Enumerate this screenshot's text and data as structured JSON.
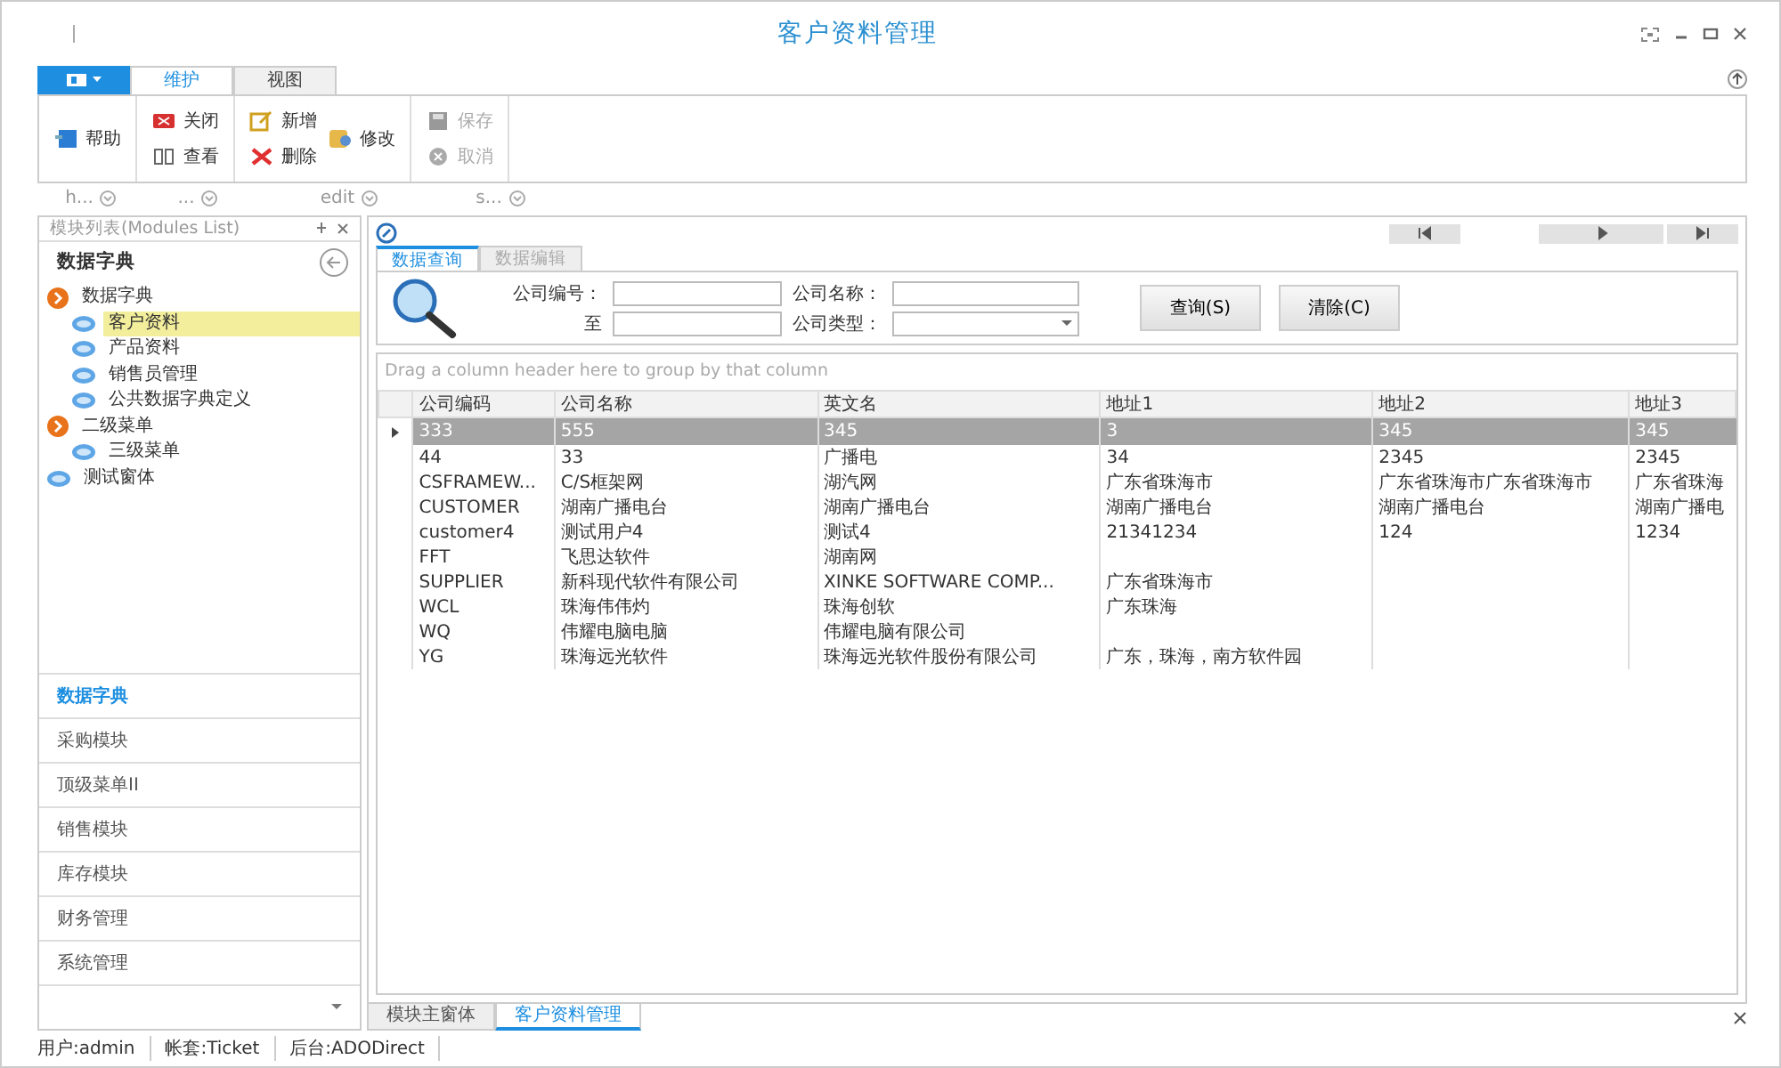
{
  "window": {
    "title": "客户资料管理"
  },
  "ribbon": {
    "tabs": [
      {
        "label": "维护",
        "selected": true
      },
      {
        "label": "视图",
        "selected": false
      }
    ],
    "groups": [
      {
        "label": "h...",
        "stacks": [
          [
            {
              "label": "帮助",
              "kind": "help",
              "disabled": false
            }
          ]
        ]
      },
      {
        "label": "...",
        "stacks": [
          [
            {
              "label": "关闭",
              "kind": "close",
              "disabled": false
            },
            {
              "label": "查看",
              "kind": "view",
              "disabled": false
            }
          ]
        ]
      },
      {
        "label": "edit",
        "stacks": [
          [
            {
              "label": "新增",
              "kind": "add",
              "disabled": false
            },
            {
              "label": "删除",
              "kind": "delete",
              "disabled": false
            }
          ],
          [
            {
              "label": "修改",
              "kind": "edit",
              "disabled": false
            }
          ]
        ]
      },
      {
        "label": "s...",
        "stacks": [
          [
            {
              "label": "保存",
              "kind": "save",
              "disabled": true
            },
            {
              "label": "取消",
              "kind": "cancel",
              "disabled": true
            }
          ]
        ]
      }
    ]
  },
  "sidebar": {
    "title": "模块列表(Modules List)",
    "header": "数据字典",
    "tree": [
      {
        "label": "数据字典",
        "kind": "folder",
        "expanded": true,
        "selected": false,
        "children": [
          {
            "label": "客户资料",
            "kind": "form",
            "selected": true
          },
          {
            "label": "产品资料",
            "kind": "form",
            "selected": false
          },
          {
            "label": "销售员管理",
            "kind": "form",
            "selected": false
          },
          {
            "label": "公共数据字典定义",
            "kind": "form",
            "selected": false
          }
        ]
      },
      {
        "label": "二级菜单",
        "kind": "folder",
        "expanded": true,
        "selected": false,
        "children": [
          {
            "label": "三级菜单",
            "kind": "form",
            "selected": false
          }
        ]
      },
      {
        "label": "测试窗体",
        "kind": "form",
        "selected": false
      }
    ],
    "modules": [
      {
        "label": "数据字典",
        "selected": true
      },
      {
        "label": "采购模块",
        "selected": false
      },
      {
        "label": "顶级菜单II",
        "selected": false
      },
      {
        "label": "销售模块",
        "selected": false
      },
      {
        "label": "库存模块",
        "selected": false
      },
      {
        "label": "财务管理",
        "selected": false
      },
      {
        "label": "系统管理",
        "selected": false
      }
    ]
  },
  "content": {
    "tabs": [
      {
        "label": "数据查询",
        "selected": true
      },
      {
        "label": "数据编辑",
        "selected": false
      }
    ],
    "query": {
      "fields": [
        {
          "label": "公司编号：",
          "kind": "text"
        },
        {
          "label": "公司名称：",
          "kind": "text"
        },
        {
          "label": "至",
          "kind": "text"
        },
        {
          "label": "公司类型：",
          "kind": "select"
        }
      ],
      "buttons": [
        "查询(S)",
        "清除(C)"
      ]
    },
    "grid": {
      "group_hint": "Drag a column header here to group by that column",
      "columns": [
        "公司编码",
        "公司名称",
        "英文名",
        "地址1",
        "地址2",
        "地址3"
      ],
      "rows": [
        {
          "selected": true,
          "cells": [
            "333",
            "555",
            "345",
            "3",
            "345",
            "345"
          ]
        },
        {
          "selected": false,
          "cells": [
            "44",
            "33",
            "广播电",
            "34",
            "2345",
            "2345"
          ]
        },
        {
          "selected": false,
          "cells": [
            "CSFRAMEW...",
            "C/S框架网",
            "湖汽网",
            "广东省珠海市",
            "广东省珠海市广东省珠海市",
            "广东省珠海"
          ]
        },
        {
          "selected": false,
          "cells": [
            "CUSTOMER",
            "湖南广播电台",
            "湖南广播电台",
            "湖南广播电台",
            "湖南广播电台",
            "湖南广播电"
          ]
        },
        {
          "selected": false,
          "cells": [
            "customer4",
            "测试用户4",
            "测试4",
            "21341234",
            "124",
            "1234"
          ]
        },
        {
          "selected": false,
          "cells": [
            "FFT",
            "飞思达软件",
            "湖南网",
            "",
            "",
            ""
          ]
        },
        {
          "selected": false,
          "cells": [
            "SUPPLIER",
            "新科现代软件有限公司",
            "XINKE SOFTWARE COMP...",
            "广东省珠海市",
            "",
            ""
          ]
        },
        {
          "selected": false,
          "cells": [
            "WCL",
            "珠海伟伟灼",
            "珠海创软",
            "广东珠海",
            "",
            ""
          ]
        },
        {
          "selected": false,
          "cells": [
            "WQ",
            "伟耀电脑电脑",
            "伟耀电脑有限公司",
            "",
            "",
            ""
          ]
        },
        {
          "selected": false,
          "cells": [
            "YG",
            "珠海远光软件",
            "珠海远光软件股份有限公司",
            "广东，珠海，南方软件园",
            "",
            ""
          ]
        }
      ]
    }
  },
  "doc_tabs": [
    {
      "label": "模块主窗体",
      "selected": false
    },
    {
      "label": "客户资料管理",
      "selected": true
    }
  ],
  "status_bar": [
    "用户:admin",
    "帐套:Ticket",
    "后台:ADODirect"
  ]
}
